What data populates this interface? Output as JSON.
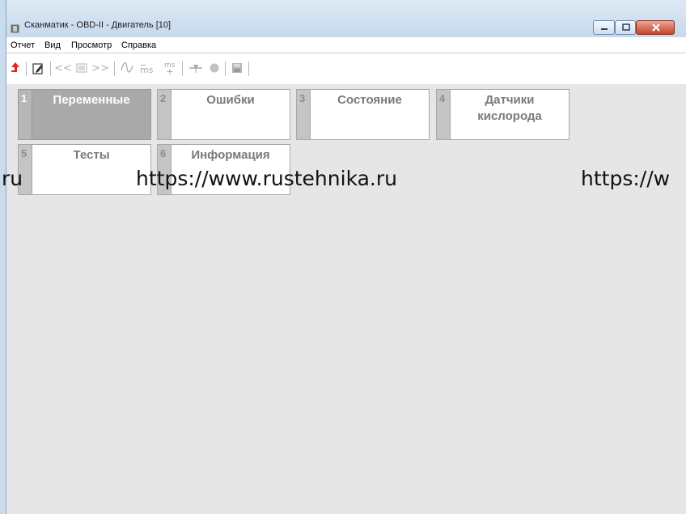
{
  "window": {
    "title": "Сканматик - OBD-II - Двигатель [10]"
  },
  "menu": {
    "items": [
      "Отчет",
      "Вид",
      "Просмотр",
      "Справка"
    ]
  },
  "toolbar": {
    "prev_label": "<<",
    "next_label": ">>",
    "ms_label": "ms"
  },
  "tabs": [
    {
      "num": "1",
      "label": "Переменные"
    },
    {
      "num": "2",
      "label": "Ошибки"
    },
    {
      "num": "3",
      "label": "Состояние"
    },
    {
      "num": "4",
      "label": "Датчики кислорода"
    },
    {
      "num": "5",
      "label": "Тесты"
    },
    {
      "num": "6",
      "label": "Информация"
    }
  ],
  "watermark": {
    "left": ".ru",
    "middle": "https://www.rustehnika.ru",
    "right": "https://w"
  },
  "colors": {
    "accent_red": "#e0241b",
    "active_tab": "#a9a9a9",
    "background": "#e6e6e6"
  }
}
